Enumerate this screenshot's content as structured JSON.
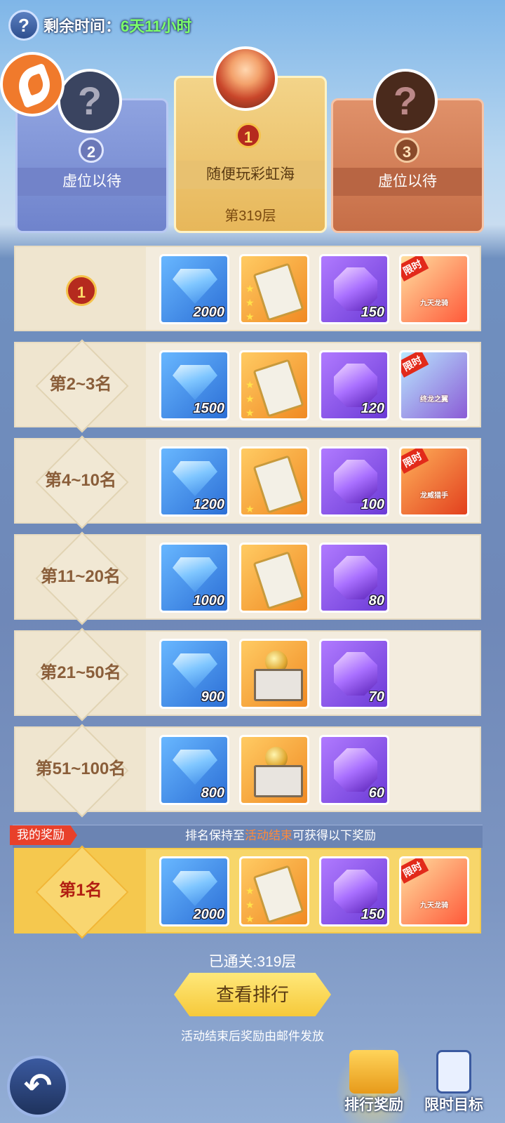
{
  "header": {
    "help_icon": "question-icon",
    "remaining_label": "剩余时间：",
    "remaining_value": "6天11小时"
  },
  "podium": {
    "second": {
      "avatar": "?",
      "rank": "2",
      "name": "虚位以待"
    },
    "first": {
      "rank": "1",
      "name": "随便玩彩虹海",
      "floor": "第319层"
    },
    "third": {
      "avatar": "?",
      "rank": "3",
      "name": "虚位以待"
    }
  },
  "rows": [
    {
      "rank": "1",
      "gems": "2000",
      "crystal": "150",
      "card_tag": "限时",
      "card_name": "九天龙骑"
    },
    {
      "rank": "第2~3名",
      "gems": "1500",
      "crystal": "120",
      "card_tag": "限时",
      "card_name": "终龙之翼"
    },
    {
      "rank": "第4~10名",
      "gems": "1200",
      "crystal": "100",
      "card_tag": "限时",
      "card_name": "龙威猎手"
    },
    {
      "rank": "第11~20名",
      "gems": "1000",
      "crystal": "80"
    },
    {
      "rank": "第21~50名",
      "gems": "900",
      "crystal": "70"
    },
    {
      "rank": "第51~100名",
      "gems": "800",
      "crystal": "60"
    }
  ],
  "my_reward": {
    "tag": "我的奖励",
    "note_a": "排名保持至",
    "note_hl": "活动结束",
    "note_b": "可获得以下奖励",
    "rank": "第1名",
    "gems": "2000",
    "crystal": "150",
    "card_tag": "限时",
    "card_name": "九天龙骑"
  },
  "footer": {
    "floor_cleared": "已通关:319层",
    "view_rank": "查看排行",
    "mail_note": "活动结束后奖励由邮件发放",
    "tab_rank_reward": "排行奖励",
    "tab_limited_goal": "限时目标"
  },
  "colors": {
    "timer_value": "#7dff6a",
    "highlight": "#ff8a3a"
  }
}
